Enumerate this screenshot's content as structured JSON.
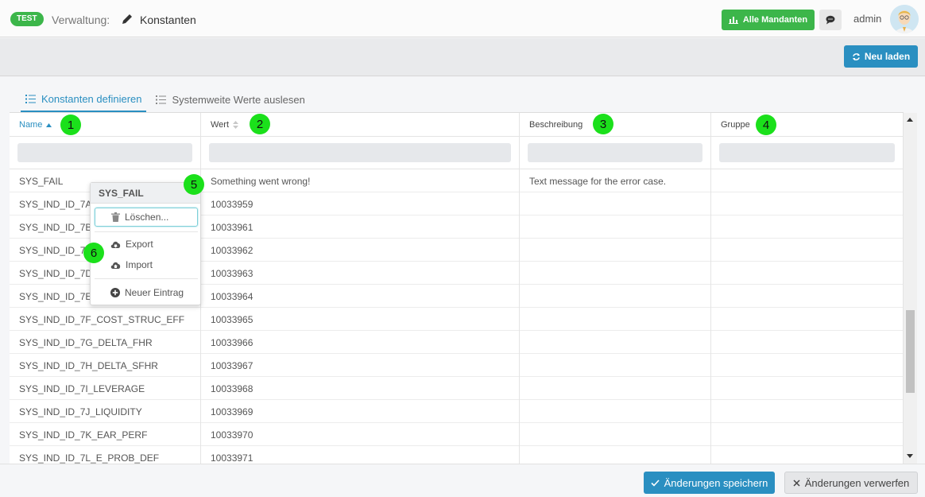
{
  "header": {
    "env_badge": "TEST",
    "breadcrumb_root": "Verwaltung:",
    "breadcrumb_icon": "pencil-icon",
    "breadcrumb_current": "Konstanten",
    "mandanten_button": "Alle Mandanten",
    "mandanten_icon": "bar-chart-icon",
    "chat_icon": "chat-bubble-icon",
    "user": "admin"
  },
  "toolbar": {
    "reload_label": "Neu laden",
    "reload_icon": "refresh-icon"
  },
  "tabs": [
    {
      "label": "Konstanten definieren",
      "icon": "list-icon",
      "active": true
    },
    {
      "label": "Systemweite Werte auslesen",
      "icon": "list-icon",
      "active": false
    }
  ],
  "grid": {
    "columns": [
      {
        "label": "Name",
        "sort": "ascending",
        "marker": "1"
      },
      {
        "label": "Wert",
        "sort": "sortable",
        "marker": "2"
      },
      {
        "label": "Beschreibung",
        "marker": "3"
      },
      {
        "label": "Gruppe",
        "marker": "4"
      }
    ],
    "rows": [
      {
        "name": "SYS_FAIL",
        "wert": "Something went wrong!",
        "beschreibung": "Text message for the error case.",
        "gruppe": ""
      },
      {
        "name": "SYS_IND_ID_7A_",
        "wert": "10033959",
        "beschreibung": "",
        "gruppe": ""
      },
      {
        "name": "SYS_IND_ID_7B_",
        "wert": "10033961",
        "beschreibung": "",
        "gruppe": ""
      },
      {
        "name": "SYS_IND_ID_7C",
        "wert": "10033962",
        "beschreibung": "",
        "gruppe": ""
      },
      {
        "name": "SYS_IND_ID_7D_",
        "wert": "10033963",
        "beschreibung": "",
        "gruppe": ""
      },
      {
        "name": "SYS_IND_ID_7E_",
        "wert": "10033964",
        "beschreibung": "",
        "gruppe": ""
      },
      {
        "name": "SYS_IND_ID_7F_COST_STRUC_EFF",
        "wert": "10033965",
        "beschreibung": "",
        "gruppe": ""
      },
      {
        "name": "SYS_IND_ID_7G_DELTA_FHR",
        "wert": "10033966",
        "beschreibung": "",
        "gruppe": ""
      },
      {
        "name": "SYS_IND_ID_7H_DELTA_SFHR",
        "wert": "10033967",
        "beschreibung": "",
        "gruppe": ""
      },
      {
        "name": "SYS_IND_ID_7I_LEVERAGE",
        "wert": "10033968",
        "beschreibung": "",
        "gruppe": ""
      },
      {
        "name": "SYS_IND_ID_7J_LIQUIDITY",
        "wert": "10033969",
        "beschreibung": "",
        "gruppe": ""
      },
      {
        "name": "SYS_IND_ID_7K_EAR_PERF",
        "wert": "10033970",
        "beschreibung": "",
        "gruppe": ""
      },
      {
        "name": "SYS_IND_ID_7L_E_PROB_DEF",
        "wert": "10033971",
        "beschreibung": "",
        "gruppe": ""
      }
    ]
  },
  "context_menu": {
    "title": "SYS_FAIL",
    "items": [
      {
        "label": "Löschen...",
        "icon": "trash-icon"
      },
      {
        "label": "Export",
        "icon": "cloud-download-icon"
      },
      {
        "label": "Import",
        "icon": "cloud-upload-icon"
      },
      {
        "label": "Neuer Eintrag",
        "icon": "plus-circle-icon"
      }
    ]
  },
  "markers": {
    "m5": "5",
    "m6": "6"
  },
  "footer": {
    "save_label": "Änderungen speichern",
    "save_icon": "check-icon",
    "discard_label": "Änderungen verwerfen",
    "discard_icon": "x-icon"
  },
  "colors": {
    "brand_green": "#3cb64a",
    "primary_blue": "#2a8fc1",
    "marker_green": "#1be01b"
  }
}
